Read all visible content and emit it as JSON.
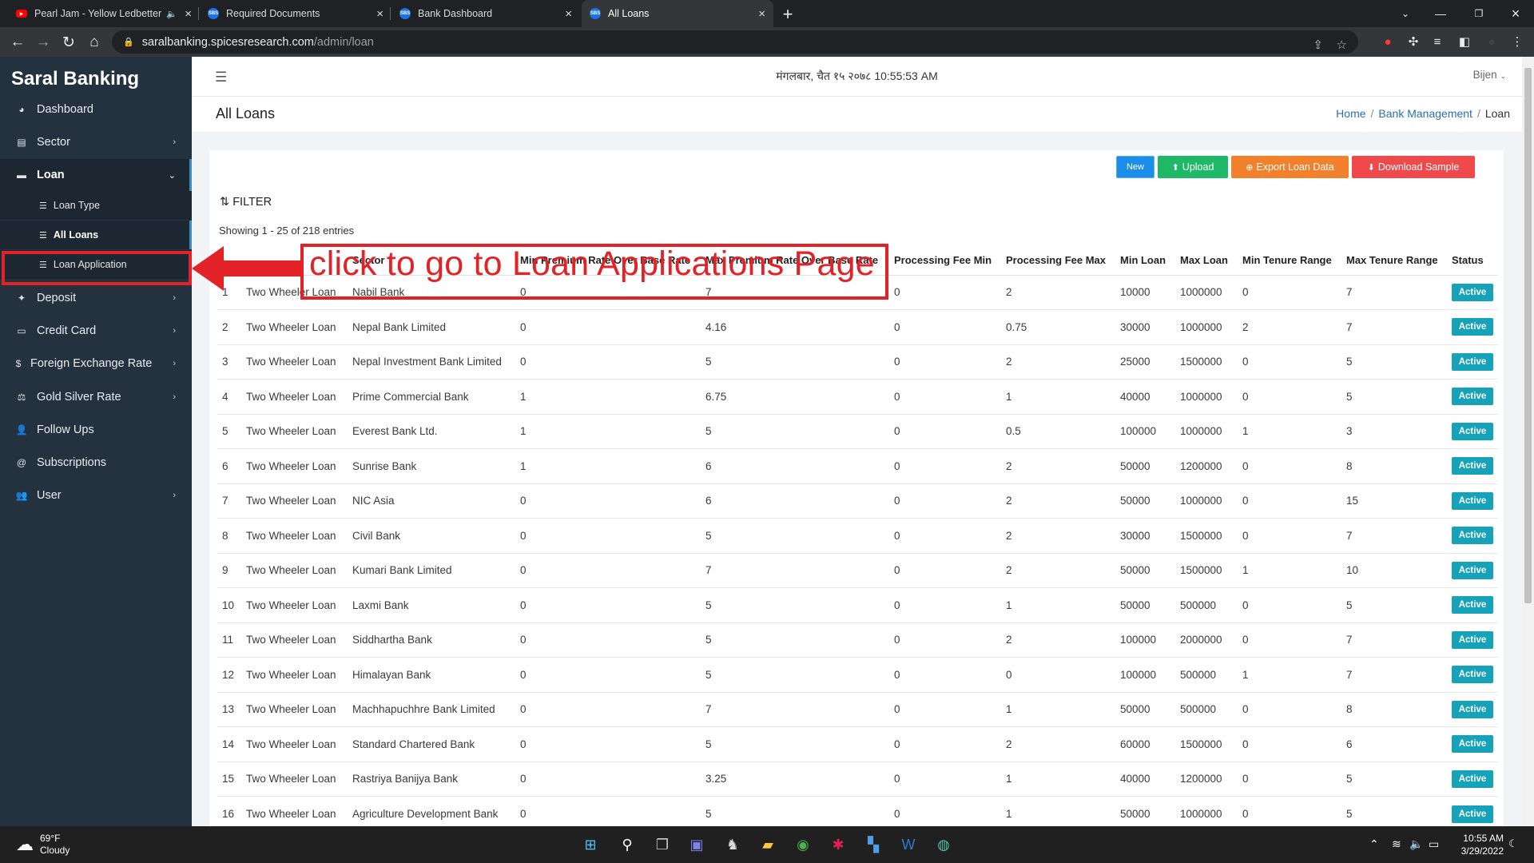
{
  "browser": {
    "tabs": [
      {
        "title": "Pearl Jam - Yellow Ledbetter",
        "favicon": "youtube-icon",
        "color": "#ff0000"
      },
      {
        "title": "Required Documents",
        "favicon": "sbs-icon",
        "color": "#1a73e8"
      },
      {
        "title": "Bank Dashboard",
        "favicon": "sbs-icon",
        "color": "#1a73e8"
      },
      {
        "title": "All Loans",
        "favicon": "sbs-icon",
        "color": "#1a73e8",
        "active": true
      }
    ],
    "url_host": "saralbanking.spicesresearch.com",
    "url_path": "/admin/loan"
  },
  "sidebar": {
    "brand": "Saral Banking",
    "items": [
      {
        "label": "Dashboard",
        "icon": "dashboard-icon"
      },
      {
        "label": "Sector",
        "icon": "sector-icon",
        "chevron": true
      },
      {
        "label": "Loan",
        "icon": "loan-icon",
        "chevron": true,
        "open": true
      },
      {
        "label": "Deposit",
        "icon": "deposit-icon",
        "chevron": true
      },
      {
        "label": "Credit Card",
        "icon": "credit-card-icon",
        "chevron": true
      },
      {
        "label": "Foreign Exchange Rate",
        "icon": "dollar-icon",
        "chevron": true
      },
      {
        "label": "Gold Silver Rate",
        "icon": "gold-icon",
        "chevron": true
      },
      {
        "label": "Follow Ups",
        "icon": "user-plus-icon"
      },
      {
        "label": "Subscriptions",
        "icon": "at-icon"
      },
      {
        "label": "User",
        "icon": "users-icon",
        "chevron": true
      }
    ],
    "loan_sub": [
      {
        "label": "Loan Type"
      },
      {
        "label": "All Loans",
        "current": true
      },
      {
        "label": "Loan Application"
      }
    ]
  },
  "topbar": {
    "datetime": "मंगलबार, चैत १५ २०७८ 10:55:53 AM",
    "user": "Bijen"
  },
  "page": {
    "title": "All Loans",
    "breadcrumb": [
      "Home",
      "Bank Management",
      "Loan"
    ]
  },
  "toolbar": {
    "new": "New",
    "upload": "Upload",
    "export": "Export Loan Data",
    "download": "Download Sample"
  },
  "filter_label": "FILTER",
  "showing": "Showing 1 - 25 of 218 entries",
  "table": {
    "headers": [
      "",
      "",
      "Sector",
      "Min Premium Rate Over Base Rate",
      "Max Premium Rate Over Base Rate",
      "Processing Fee Min",
      "Processing Fee Max",
      "Min Loan",
      "Max Loan",
      "Min Tenure Range",
      "Max Tenure Range",
      "Status"
    ],
    "rows": [
      [
        "1",
        "Two Wheeler Loan",
        "Nabil Bank",
        "0",
        "7",
        "0",
        "2",
        "10000",
        "1000000",
        "0",
        "7",
        "Active"
      ],
      [
        "2",
        "Two Wheeler Loan",
        "Nepal Bank Limited",
        "0",
        "4.16",
        "0",
        "0.75",
        "30000",
        "1000000",
        "2",
        "7",
        "Active"
      ],
      [
        "3",
        "Two Wheeler Loan",
        "Nepal Investment Bank Limited",
        "0",
        "5",
        "0",
        "2",
        "25000",
        "1500000",
        "0",
        "5",
        "Active"
      ],
      [
        "4",
        "Two Wheeler Loan",
        "Prime Commercial Bank",
        "1",
        "6.75",
        "0",
        "1",
        "40000",
        "1000000",
        "0",
        "5",
        "Active"
      ],
      [
        "5",
        "Two Wheeler Loan",
        "Everest Bank Ltd.",
        "1",
        "5",
        "0",
        "0.5",
        "100000",
        "1000000",
        "1",
        "3",
        "Active"
      ],
      [
        "6",
        "Two Wheeler Loan",
        "Sunrise Bank",
        "1",
        "6",
        "0",
        "2",
        "50000",
        "1200000",
        "0",
        "8",
        "Active"
      ],
      [
        "7",
        "Two Wheeler Loan",
        "NIC Asia",
        "0",
        "6",
        "0",
        "2",
        "50000",
        "1000000",
        "0",
        "15",
        "Active"
      ],
      [
        "8",
        "Two Wheeler Loan",
        "Civil Bank",
        "0",
        "5",
        "0",
        "2",
        "30000",
        "1500000",
        "0",
        "7",
        "Active"
      ],
      [
        "9",
        "Two Wheeler Loan",
        "Kumari Bank Limited",
        "0",
        "7",
        "0",
        "2",
        "50000",
        "1500000",
        "1",
        "10",
        "Active"
      ],
      [
        "10",
        "Two Wheeler Loan",
        "Laxmi Bank",
        "0",
        "5",
        "0",
        "1",
        "50000",
        "500000",
        "0",
        "5",
        "Active"
      ],
      [
        "11",
        "Two Wheeler Loan",
        "Siddhartha Bank",
        "0",
        "5",
        "0",
        "2",
        "100000",
        "2000000",
        "0",
        "7",
        "Active"
      ],
      [
        "12",
        "Two Wheeler Loan",
        "Himalayan Bank",
        "0",
        "5",
        "0",
        "0",
        "100000",
        "500000",
        "1",
        "7",
        "Active"
      ],
      [
        "13",
        "Two Wheeler Loan",
        "Machhapuchhre Bank Limited",
        "0",
        "7",
        "0",
        "1",
        "50000",
        "500000",
        "0",
        "8",
        "Active"
      ],
      [
        "14",
        "Two Wheeler Loan",
        "Standard Chartered Bank",
        "0",
        "5",
        "0",
        "2",
        "60000",
        "1500000",
        "0",
        "6",
        "Active"
      ],
      [
        "15",
        "Two Wheeler Loan",
        "Rastriya Banijya Bank",
        "0",
        "3.25",
        "0",
        "1",
        "40000",
        "1200000",
        "0",
        "5",
        "Active"
      ],
      [
        "16",
        "Two Wheeler Loan",
        "Agriculture Development Bank",
        "0",
        "5",
        "0",
        "1",
        "50000",
        "1000000",
        "0",
        "5",
        "Active"
      ]
    ]
  },
  "annotation": {
    "text": "click to go to Loan Applications Page",
    "color": "#e32228"
  },
  "taskbar": {
    "temp": "69°F",
    "condition": "Cloudy",
    "time": "10:55 AM",
    "date": "3/29/2022"
  }
}
